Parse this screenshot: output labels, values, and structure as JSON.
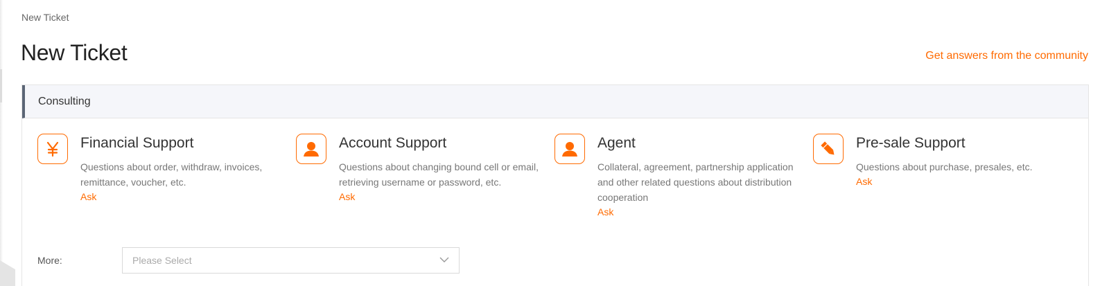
{
  "breadcrumb": "New Ticket",
  "page_title": "New Ticket",
  "community_link": "Get answers from the community",
  "section": {
    "title": "Consulting"
  },
  "cards": [
    {
      "icon": "yen-icon",
      "title": "Financial Support",
      "description": "Questions about order, withdraw, invoices, remittance, voucher, etc.",
      "action": "Ask"
    },
    {
      "icon": "user-icon",
      "title": "Account Support",
      "description": "Questions about changing bound cell or email, retrieving username or password, etc.",
      "action": "Ask"
    },
    {
      "icon": "user-icon",
      "title": "Agent",
      "description": "Collateral, agreement, partnership application and other related questions about distribution cooperation",
      "action": "Ask"
    },
    {
      "icon": "pencil-icon",
      "title": "Pre-sale Support",
      "description": "Questions about purchase, presales, etc.",
      "action": "Ask"
    }
  ],
  "more": {
    "label": "More:",
    "placeholder": "Please Select"
  },
  "colors": {
    "accent": "#ff6a00",
    "header_bg": "#f5f6fa",
    "header_bar": "#5b6575"
  }
}
